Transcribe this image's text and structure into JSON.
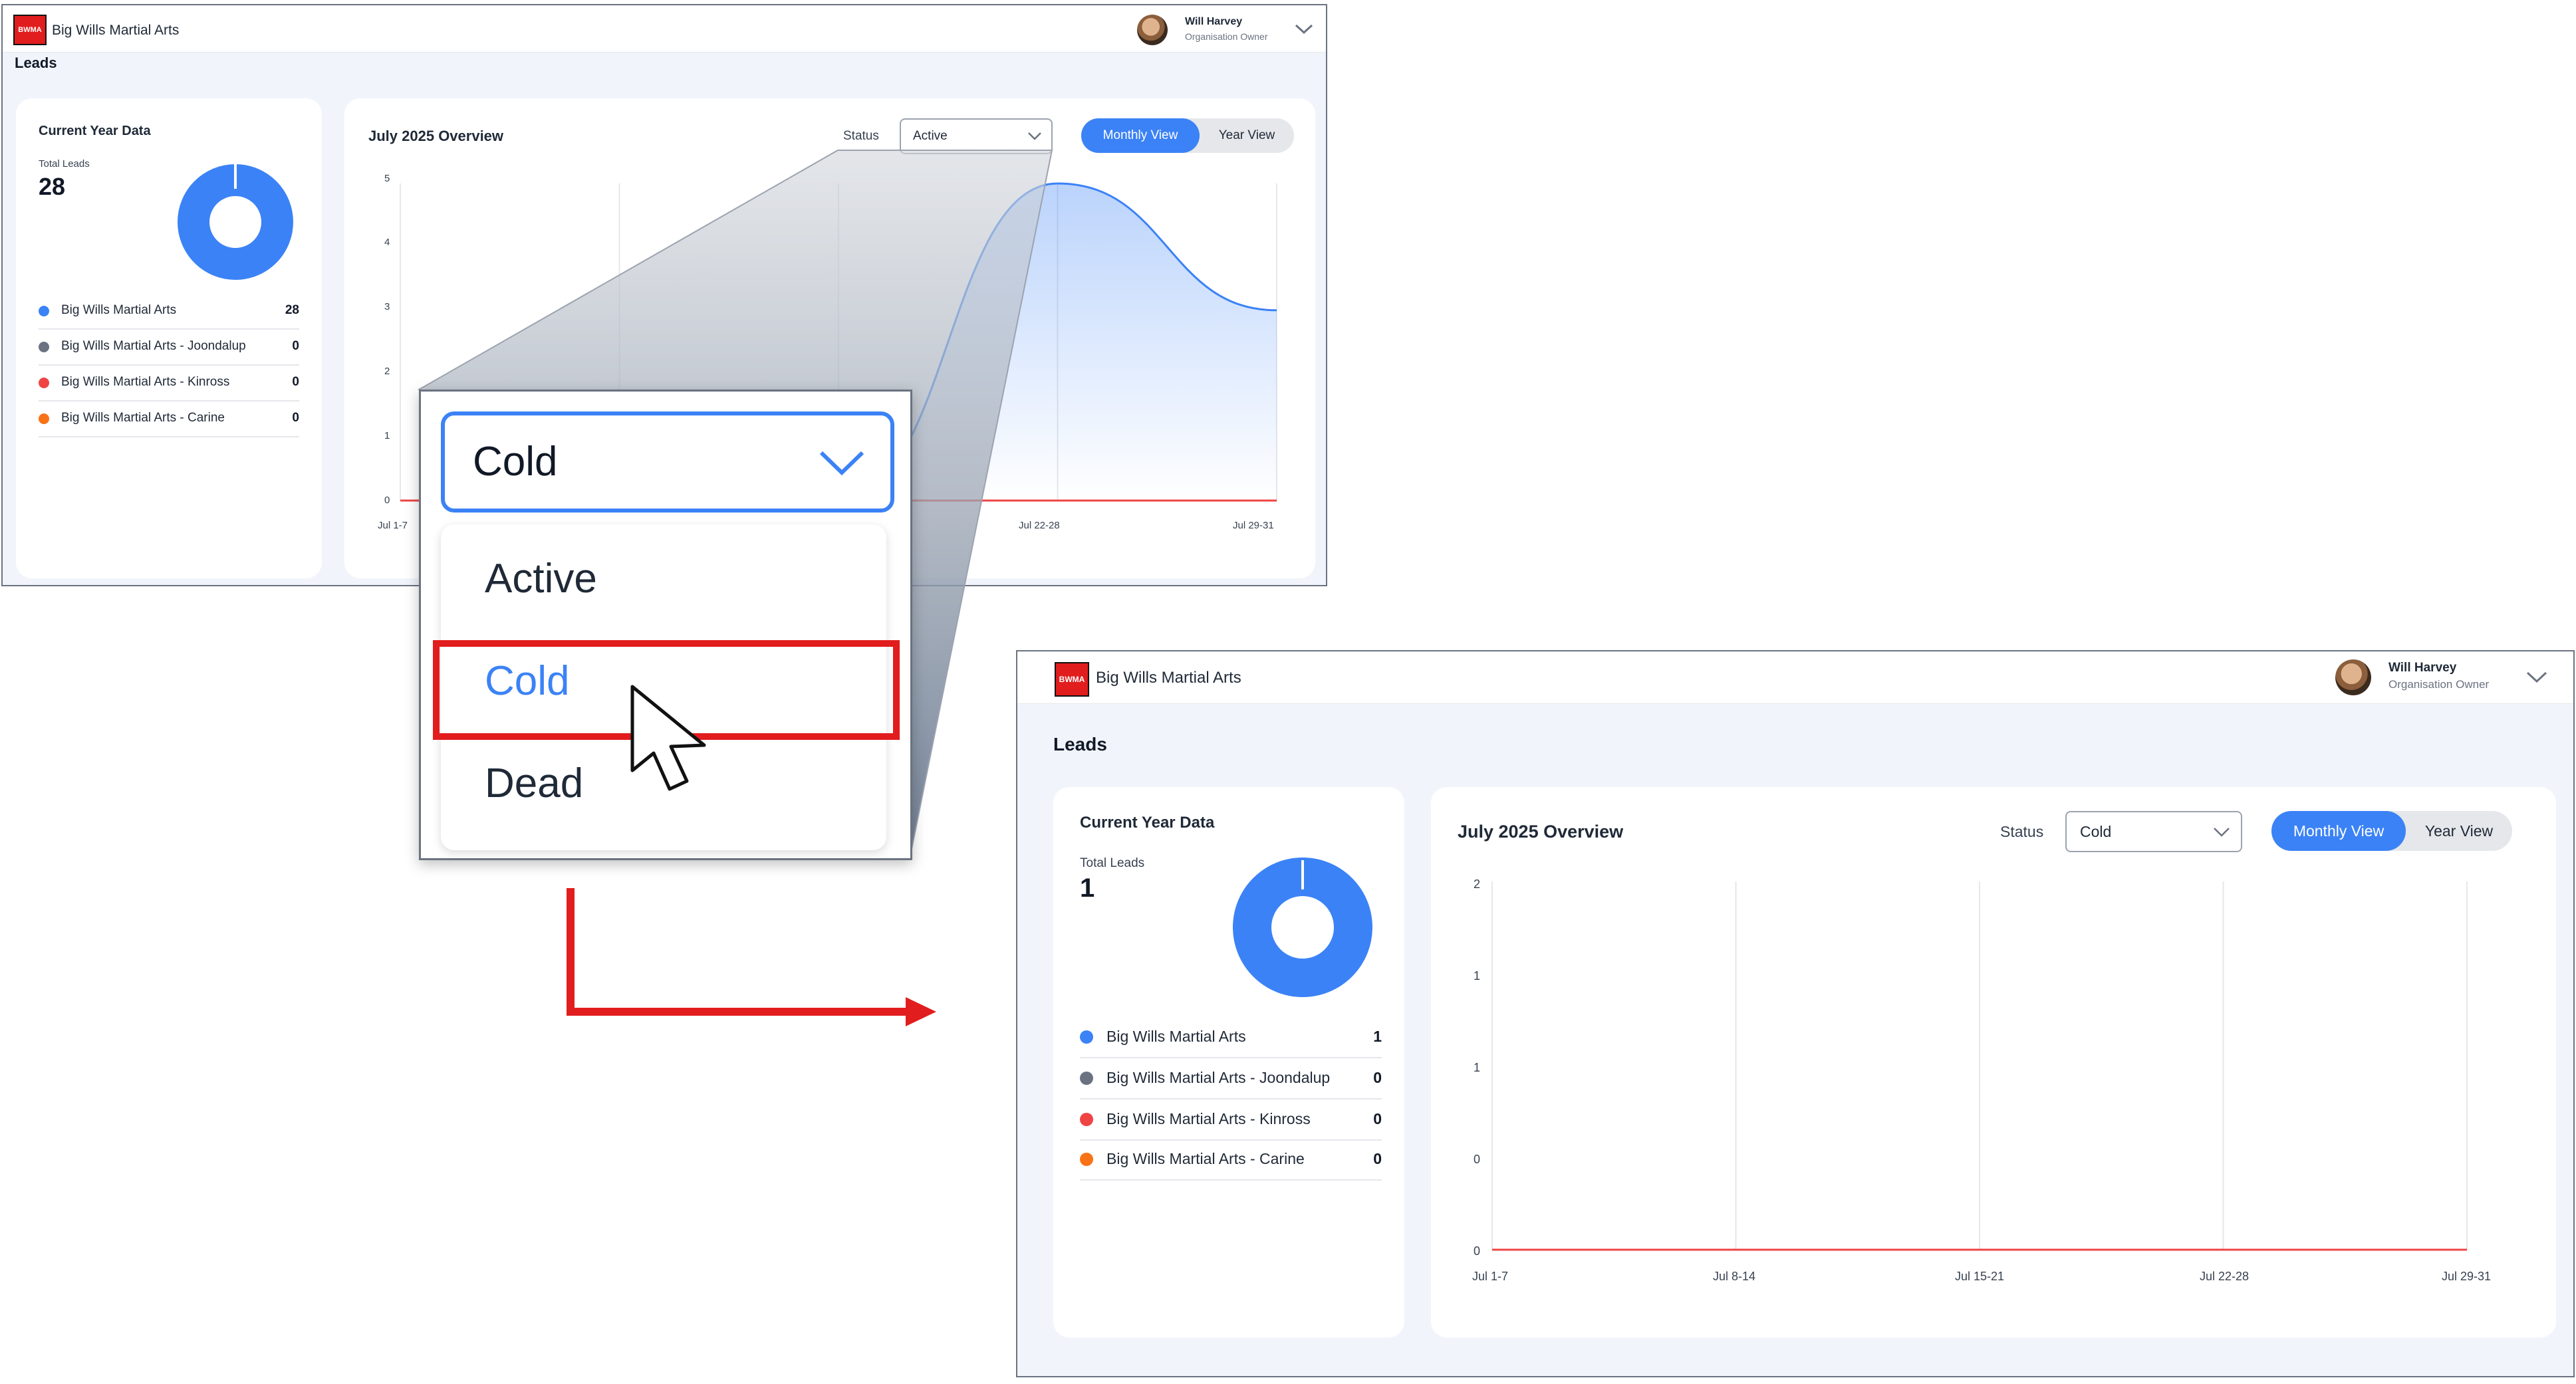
{
  "colors": {
    "accent": "#3b82f6",
    "legend": [
      "#3b82f6",
      "#6b7280",
      "#ef4444",
      "#f97316"
    ],
    "annotation_red": "#e11d1d",
    "series_line": "#3b82f6",
    "zero_line": "#ef4444"
  },
  "before": {
    "app": {
      "name": "Big Wills Martial Arts",
      "logo_text": "BWMA"
    },
    "user": {
      "name": "Will Harvey",
      "role": "Organisation Owner"
    },
    "page_title": "Leads",
    "left_card": {
      "title": "Current Year Data",
      "total_label": "Total Leads",
      "total_value": "28",
      "legend": [
        {
          "name": "Big Wills Martial Arts",
          "value": "28"
        },
        {
          "name": "Big Wills Martial Arts - Joondalup",
          "value": "0"
        },
        {
          "name": "Big Wills Martial Arts - Kinross",
          "value": "0"
        },
        {
          "name": "Big Wills Martial Arts - Carine",
          "value": "0"
        }
      ]
    },
    "overview": {
      "title": "July 2025 Overview",
      "status_label": "Status",
      "status_value": "Active",
      "monthly_label": "Monthly View",
      "year_label": "Year View"
    }
  },
  "dropdown_zoom": {
    "selected_value": "Cold",
    "options": [
      "Active",
      "Cold",
      "Dead"
    ],
    "highlighted": "Cold"
  },
  "after": {
    "app": {
      "name": "Big Wills Martial Arts",
      "logo_text": "BWMA"
    },
    "user": {
      "name": "Will Harvey",
      "role": "Organisation Owner"
    },
    "page_title": "Leads",
    "left_card": {
      "title": "Current Year Data",
      "total_label": "Total Leads",
      "total_value": "1",
      "legend": [
        {
          "name": "Big Wills Martial Arts",
          "value": "1"
        },
        {
          "name": "Big Wills Martial Arts - Joondalup",
          "value": "0"
        },
        {
          "name": "Big Wills Martial Arts - Kinross",
          "value": "0"
        },
        {
          "name": "Big Wills Martial Arts - Carine",
          "value": "0"
        }
      ]
    },
    "overview": {
      "title": "July 2025 Overview",
      "status_label": "Status",
      "status_value": "Cold",
      "monthly_label": "Monthly View",
      "year_label": "Year View"
    }
  },
  "chart_data": [
    {
      "type": "pie",
      "labels": [
        "Big Wills Martial Arts",
        "Big Wills Martial Arts - Joondalup",
        "Big Wills Martial Arts - Kinross",
        "Big Wills Martial Arts - Carine"
      ],
      "values": [
        28,
        0,
        0,
        0
      ],
      "donut": true
    },
    {
      "type": "line",
      "title": "July 2025 Overview",
      "x_tick_labels": [
        "Jul 1-7",
        "Jul 22-28",
        "Jul 29-31"
      ],
      "y_tick_labels": [
        "0",
        "1",
        "2",
        "3",
        "4",
        "5"
      ],
      "x": [
        "Jul 1-7",
        "Jul 8-14",
        "Jul 15-21",
        "Jul 22-28",
        "Jul 29-31"
      ],
      "series": [
        {
          "color": "#3b82f6",
          "values": [
            0,
            0,
            0,
            5,
            3
          ]
        },
        {
          "color": "#ef4444",
          "values": [
            0,
            0,
            0,
            0,
            0
          ]
        }
      ],
      "ylim": [
        0,
        5
      ],
      "grid": "vertical"
    },
    {
      "type": "pie",
      "labels": [
        "Big Wills Martial Arts",
        "Big Wills Martial Arts - Joondalup",
        "Big Wills Martial Arts - Kinross",
        "Big Wills Martial Arts - Carine"
      ],
      "values": [
        1,
        0,
        0,
        0
      ],
      "donut": true
    },
    {
      "type": "line",
      "title": "July 2025 Overview",
      "x_tick_labels": [
        "Jul 1-7",
        "Jul 8-14",
        "Jul 15-21",
        "Jul 22-28",
        "Jul 29-31"
      ],
      "y_tick_labels": [
        "0",
        "0",
        "1",
        "1",
        "2"
      ],
      "x": [
        "Jul 1-7",
        "Jul 8-14",
        "Jul 15-21",
        "Jul 22-28",
        "Jul 29-31"
      ],
      "series": [
        {
          "color": "#ef4444",
          "values": [
            0,
            0,
            0,
            0,
            0
          ]
        }
      ],
      "ylim": [
        0,
        2
      ],
      "grid": "vertical"
    }
  ]
}
